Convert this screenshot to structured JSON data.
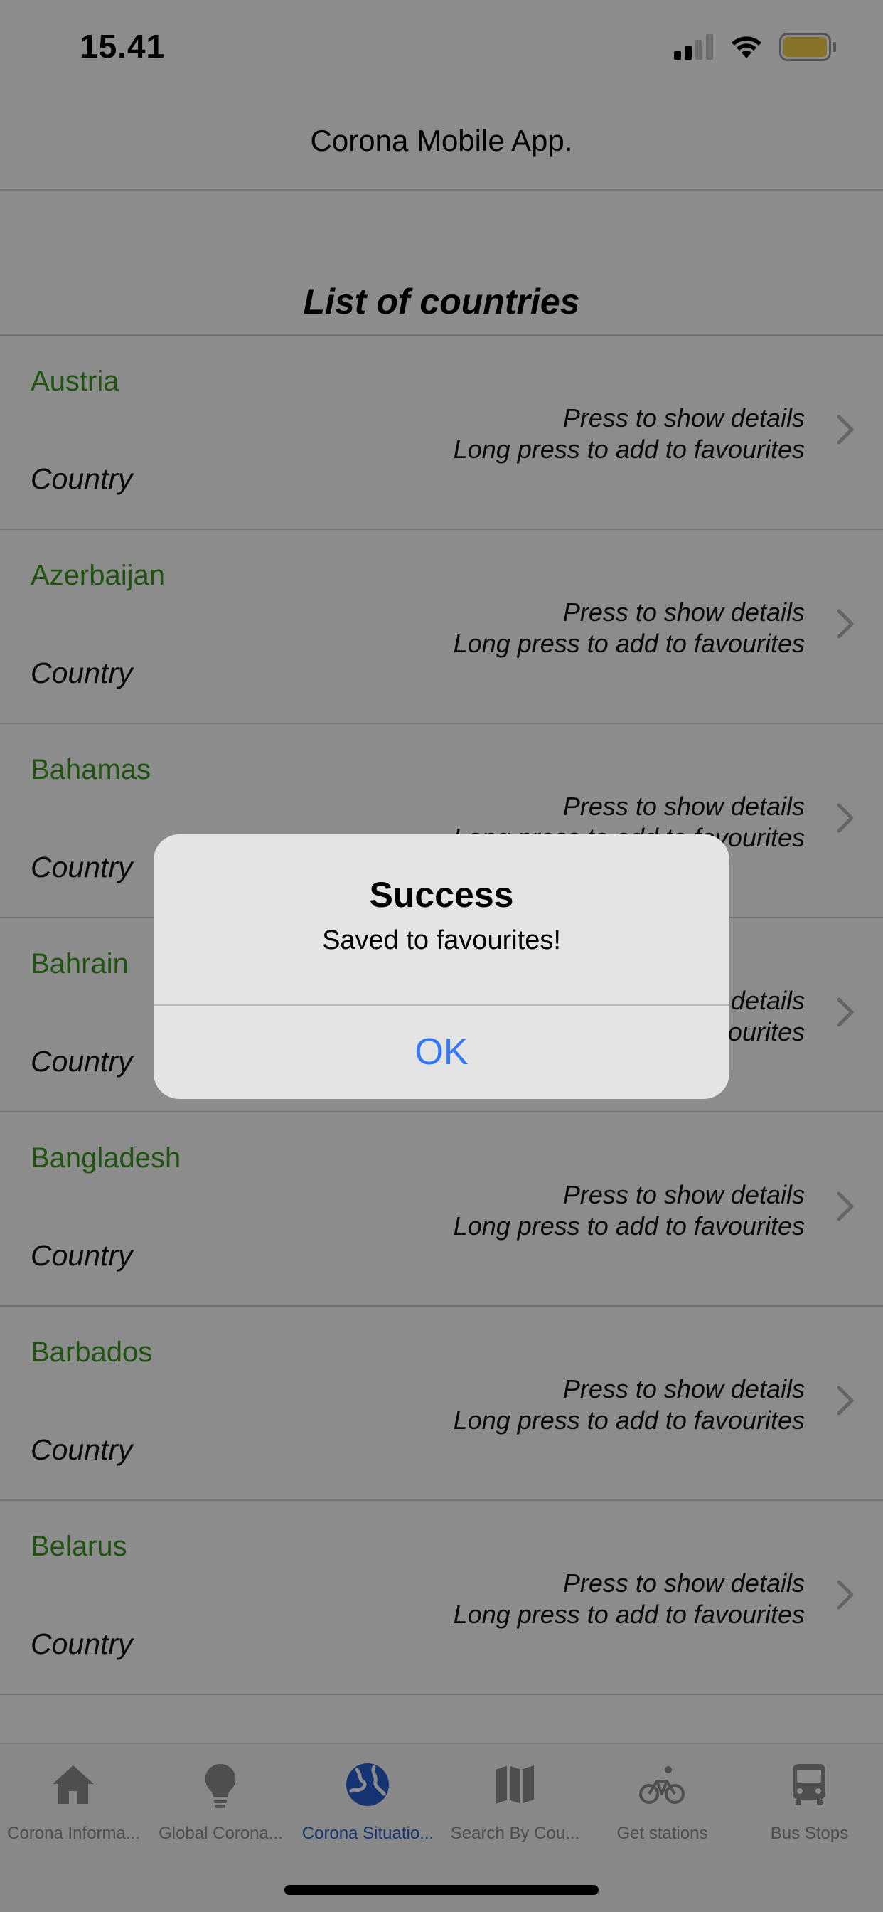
{
  "status_bar": {
    "time": "15.41",
    "battery_color": "#f7d44a"
  },
  "header": {
    "title": "Corona Mobile App."
  },
  "list": {
    "heading": "List of countries",
    "hint_line1": "Press to show details",
    "hint_line2": "Long press to add to favourites",
    "rows": [
      {
        "name": "",
        "type": "Country"
      },
      {
        "name": "Austria",
        "type": "Country"
      },
      {
        "name": "Azerbaijan",
        "type": "Country"
      },
      {
        "name": "Bahamas",
        "type": "Country"
      },
      {
        "name": "Bahrain",
        "type": "Country"
      },
      {
        "name": "Bangladesh",
        "type": "Country"
      },
      {
        "name": "Barbados",
        "type": "Country"
      },
      {
        "name": "Belarus",
        "type": "Country"
      }
    ]
  },
  "tabs": [
    {
      "label": "Corona Informa...",
      "icon": "home-icon"
    },
    {
      "label": "Global Corona...",
      "icon": "lightbulb-icon"
    },
    {
      "label": "Corona Situatio...",
      "icon": "globe-icon",
      "active": true
    },
    {
      "label": "Search By Cou...",
      "icon": "map-icon"
    },
    {
      "label": "Get stations",
      "icon": "bicycle-icon"
    },
    {
      "label": "Bus Stops",
      "icon": "bus-icon"
    }
  ],
  "alert": {
    "title": "Success",
    "message": "Saved to favourites!",
    "ok_label": "OK"
  },
  "colors": {
    "country_name": "#3d9a22",
    "active_tab": "#2a5fd0",
    "inactive_tab": "#8e8e93",
    "alert_button": "#3478f6"
  }
}
